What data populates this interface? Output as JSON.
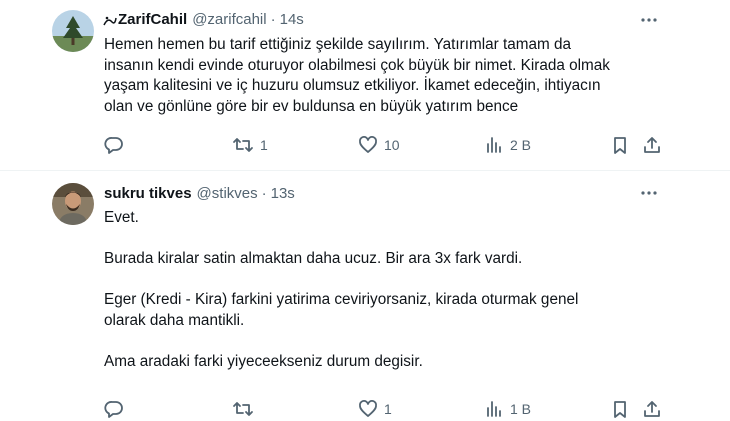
{
  "tweets": [
    {
      "display_name": "ZarifCahil",
      "handle": "@zarifcahil",
      "dot": "·",
      "time": "14s",
      "text": [
        "Hemen hemen bu tarif ettiğiniz şekilde sayılırım. Yatırımlar tamam da",
        "insanın kendi evinde oturuyor olabilmesi çok büyük bir nimet. Kirada olmak",
        "yaşam kalitesini ve iç huzuru olumsuz etkiliyor. İkamet edeceğin, ihtiyacın",
        "olan ve gönlüne göre bir ev buldunsa en büyük yatırım bence"
      ],
      "replies": "",
      "retweets": "1",
      "likes": "10",
      "views": "2 B"
    },
    {
      "display_name": "sukru tikves",
      "handle": "@stikves",
      "dot": "·",
      "time": "13s",
      "text": [
        "Evet.",
        "",
        "Burada kiralar satin almaktan daha ucuz. Bir ara 3x fark vardi.",
        "",
        "Eger (Kredi - Kira) farkini yatirima ceviriyorsaniz, kirada oturmak genel",
        "olarak daha mantikli.",
        "",
        "Ama aradaki farki yiyeceekseniz durum degisir."
      ],
      "replies": "",
      "retweets": "",
      "likes": "1",
      "views": "1 B"
    }
  ],
  "icons": {
    "reply": "reply-icon",
    "retweet": "retweet-icon",
    "like": "heart-icon",
    "views": "views-chart-icon",
    "bookmark": "bookmark-icon",
    "share": "share-icon",
    "more": "more-options-icon"
  },
  "colors": {
    "text": "#0f1419",
    "secondary": "#536471",
    "divider": "#eff3f4"
  }
}
